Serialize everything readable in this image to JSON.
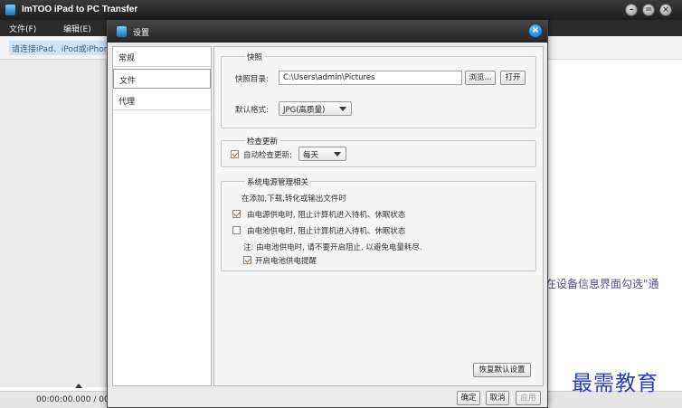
{
  "main_window": {
    "title": "ImTOO iPad to PC Transfer",
    "menu": {
      "file": "文件(F)",
      "edit": "编辑(E)"
    },
    "device_hint": "请连接iPad、iPod或iPhone",
    "right_text": "在设备信息界面勾选\"通",
    "status_time": "00:00:00.000 / 00:",
    "window_buttons": [
      "minimize-icon",
      "restore-icon",
      "close-icon"
    ]
  },
  "watermark": "最需教育",
  "dialog": {
    "title": "设置",
    "nav": [
      "常规",
      "文件",
      "代理"
    ],
    "active_nav": "文件",
    "snapshot": {
      "legend": "快照",
      "dir_label": "快照目录:",
      "dir_value": "C:\\Users\\admin\\Pictures",
      "browse": "浏览...",
      "open": "打开",
      "format_label": "默认格式:",
      "format_value": "JPG(高质量)"
    },
    "update": {
      "legend": "检查更新",
      "auto_label": "自动检查更新:",
      "auto_checked": true,
      "frequency": "每天"
    },
    "power": {
      "legend": "系统电源管理相关",
      "desc": "在添加,下载,转化或输出文件时",
      "ac_option": "由电源供电时, 阻止计算机进入待机、休眠状态",
      "ac_checked": true,
      "battery_option": "由电池供电时, 阻止计算机进入待机、休眠状态",
      "battery_checked": false,
      "note": "注: 由电池供电时, 请不要开启阻止, 以避免电量耗尽.",
      "reminder_option": "开启电池供电提醒",
      "reminder_checked": true
    },
    "restore_default": "恢复默认设置",
    "ok": "确定",
    "cancel": "取消",
    "apply": "应用"
  }
}
